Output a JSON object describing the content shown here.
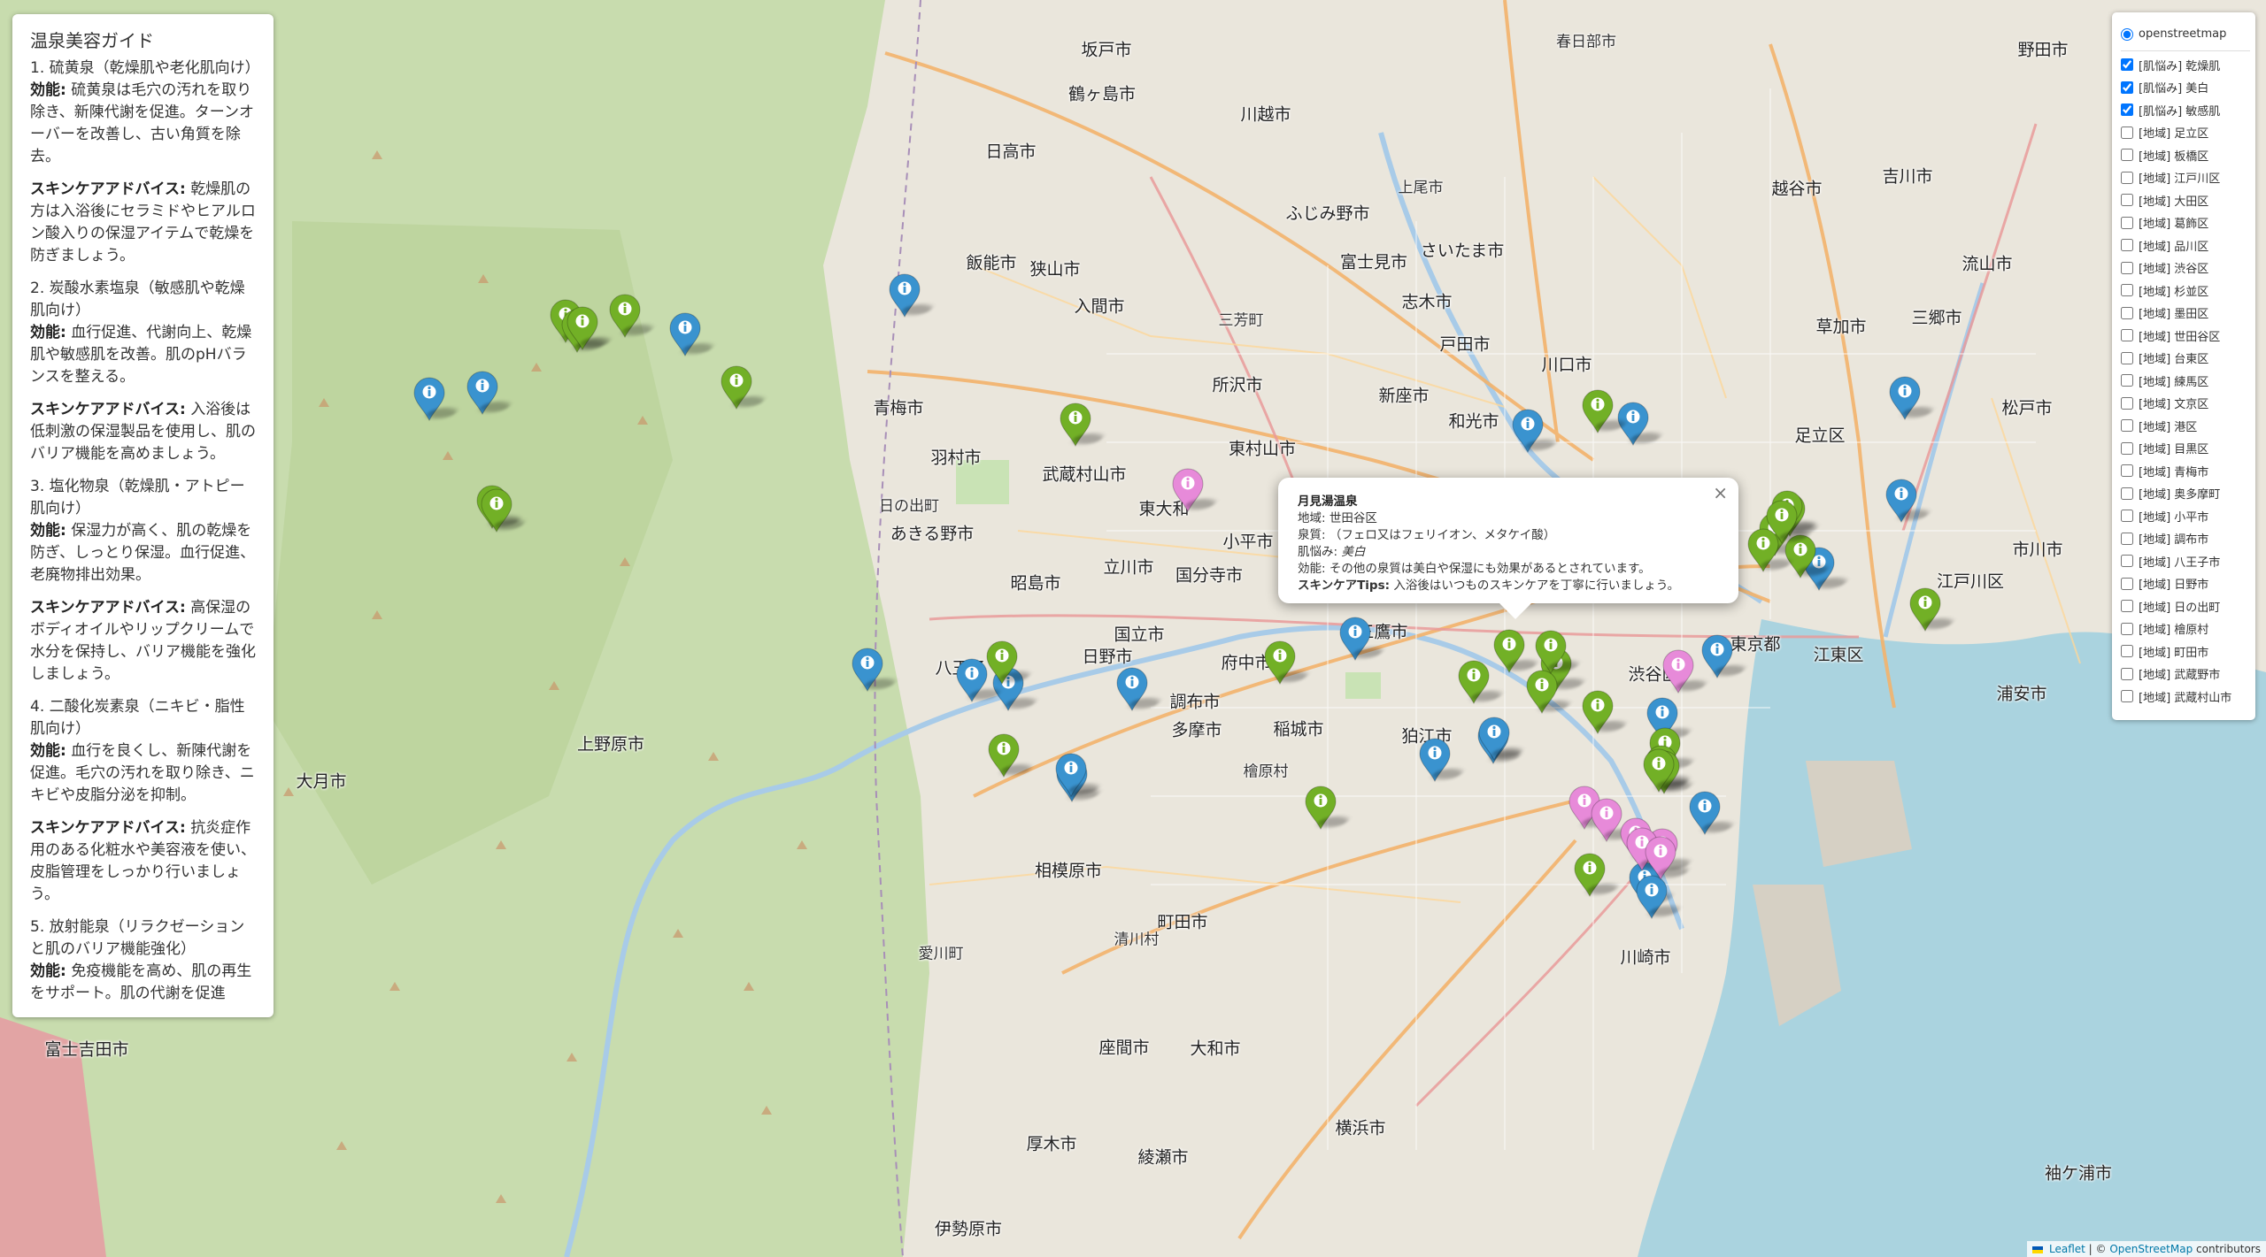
{
  "map": {
    "labels": [
      {
        "text": "坂戸市",
        "big": true
      },
      {
        "text": "鶴ヶ島市",
        "big": true
      },
      {
        "text": "日高市",
        "big": true
      },
      {
        "text": "川越市",
        "big": true
      },
      {
        "text": "ふじみ野市",
        "big": true
      },
      {
        "text": "富士見市",
        "big": true
      },
      {
        "text": "さいたま市",
        "big": true
      },
      {
        "text": "上尾市",
        "big": false
      },
      {
        "text": "春日部市",
        "big": false
      },
      {
        "text": "越谷市",
        "big": true
      },
      {
        "text": "吉川市",
        "big": true
      },
      {
        "text": "野田市",
        "big": true
      },
      {
        "text": "流山市",
        "big": true
      },
      {
        "text": "三郷市",
        "big": true
      },
      {
        "text": "草加市",
        "big": true
      },
      {
        "text": "松戸市",
        "big": true
      },
      {
        "text": "飯能市",
        "big": true
      },
      {
        "text": "狭山市",
        "big": true
      },
      {
        "text": "入間市",
        "big": true
      },
      {
        "text": "三芳町",
        "big": false
      },
      {
        "text": "志木市",
        "big": true
      },
      {
        "text": "所沢市",
        "big": true
      },
      {
        "text": "戸田市",
        "big": true
      },
      {
        "text": "川口市",
        "big": true
      },
      {
        "text": "新座市",
        "big": true
      },
      {
        "text": "和光市",
        "big": true
      },
      {
        "text": "足立区",
        "big": true
      },
      {
        "text": "青梅市",
        "big": true
      },
      {
        "text": "羽村市",
        "big": true
      },
      {
        "text": "武蔵村山市",
        "big": true
      },
      {
        "text": "東村山市",
        "big": true
      },
      {
        "text": "東大和",
        "big": true
      },
      {
        "text": "小平市",
        "big": true
      },
      {
        "text": "あきる野市",
        "big": true
      },
      {
        "text": "日の出町",
        "big": false
      },
      {
        "text": "昭島市",
        "big": true
      },
      {
        "text": "立川市",
        "big": true
      },
      {
        "text": "国分寺市",
        "big": true
      },
      {
        "text": "国立市",
        "big": true
      },
      {
        "text": "府中市",
        "big": true
      },
      {
        "text": "八王子",
        "big": true
      },
      {
        "text": "日野市",
        "big": true
      },
      {
        "text": "多摩市",
        "big": true
      },
      {
        "text": "稲城市",
        "big": true
      },
      {
        "text": "調布市",
        "big": true
      },
      {
        "text": "狛江市",
        "big": true
      },
      {
        "text": "三鷹市",
        "big": true
      },
      {
        "text": "渋谷区",
        "big": true
      },
      {
        "text": "東京都",
        "big": true
      },
      {
        "text": "江東区",
        "big": true
      },
      {
        "text": "江戸川区",
        "big": true
      },
      {
        "text": "市川市",
        "big": true
      },
      {
        "text": "浦安市",
        "big": true
      },
      {
        "text": "上野原市",
        "big": true
      },
      {
        "text": "大月市",
        "big": true
      },
      {
        "text": "相模原市",
        "big": true
      },
      {
        "text": "町田市",
        "big": true
      },
      {
        "text": "川崎市",
        "big": true
      },
      {
        "text": "座間市",
        "big": true
      },
      {
        "text": "大和市",
        "big": true
      },
      {
        "text": "厚木市",
        "big": true
      },
      {
        "text": "綾瀬市",
        "big": true
      },
      {
        "text": "横浜市",
        "big": true
      },
      {
        "text": "伊勢原市",
        "big": true
      },
      {
        "text": "富士吉田市",
        "big": true
      },
      {
        "text": "袖ケ浦市",
        "big": true
      },
      {
        "text": "愛川町",
        "big": false
      },
      {
        "text": "清川村",
        "big": false
      },
      {
        "text": "檜原村",
        "big": false
      }
    ],
    "marker_colors": {
      "blue": "#3a93cf",
      "green": "#72b026",
      "pink": "#e78ad9"
    },
    "markers": [
      {
        "color": "blue"
      },
      {
        "color": "blue"
      },
      {
        "color": "blue"
      },
      {
        "color": "blue"
      },
      {
        "color": "blue"
      },
      {
        "color": "blue"
      },
      {
        "color": "blue"
      },
      {
        "color": "blue"
      },
      {
        "color": "blue"
      },
      {
        "color": "blue"
      },
      {
        "color": "blue"
      },
      {
        "color": "blue"
      },
      {
        "color": "blue"
      },
      {
        "color": "blue"
      },
      {
        "color": "blue"
      },
      {
        "color": "blue"
      },
      {
        "color": "blue"
      },
      {
        "color": "blue"
      },
      {
        "color": "blue"
      },
      {
        "color": "blue"
      },
      {
        "color": "blue"
      },
      {
        "color": "blue"
      },
      {
        "color": "blue"
      },
      {
        "color": "blue"
      },
      {
        "color": "green"
      },
      {
        "color": "green"
      },
      {
        "color": "green"
      },
      {
        "color": "green"
      },
      {
        "color": "green"
      },
      {
        "color": "green"
      },
      {
        "color": "green"
      },
      {
        "color": "green"
      },
      {
        "color": "green"
      },
      {
        "color": "green"
      },
      {
        "color": "green"
      },
      {
        "color": "green"
      },
      {
        "color": "green"
      },
      {
        "color": "green"
      },
      {
        "color": "green"
      },
      {
        "color": "green"
      },
      {
        "color": "green"
      },
      {
        "color": "green"
      },
      {
        "color": "green"
      },
      {
        "color": "green"
      },
      {
        "color": "green"
      },
      {
        "color": "green"
      },
      {
        "color": "green"
      },
      {
        "color": "green"
      },
      {
        "color": "green"
      },
      {
        "color": "green"
      },
      {
        "color": "green"
      },
      {
        "color": "green"
      },
      {
        "color": "green"
      },
      {
        "color": "green"
      },
      {
        "color": "green"
      },
      {
        "color": "pink"
      },
      {
        "color": "pink"
      },
      {
        "color": "pink"
      },
      {
        "color": "pink"
      },
      {
        "color": "pink"
      },
      {
        "color": "pink"
      },
      {
        "color": "pink"
      },
      {
        "color": "pink"
      }
    ]
  },
  "guide": {
    "title": "温泉美容ガイド",
    "items": [
      {
        "heading": "1. 硫黄泉（乾燥肌や老化肌向け）",
        "effect_label": "効能:",
        "effect": "硫黄泉は毛穴の汚れを取り除き、新陳代謝を促進。ターンオーバーを改善し、古い角質を除去。",
        "advice_label": "スキンケアアドバイス:",
        "advice": "乾燥肌の方は入浴後にセラミドやヒアルロン酸入りの保湿アイテムで乾燥を防ぎましょう。"
      },
      {
        "heading": "2. 炭酸水素塩泉（敏感肌や乾燥肌向け）",
        "effect_label": "効能:",
        "effect": "血行促進、代謝向上、乾燥肌や敏感肌を改善。肌のpHバランスを整える。",
        "advice_label": "スキンケアアドバイス:",
        "advice": "入浴後は低刺激の保湿製品を使用し、肌のバリア機能を高めましょう。"
      },
      {
        "heading": "3. 塩化物泉（乾燥肌・アトピー肌向け）",
        "effect_label": "効能:",
        "effect": "保湿力が高く、肌の乾燥を防ぎ、しっとり保湿。血行促進、老廃物排出効果。",
        "advice_label": "スキンケアアドバイス:",
        "advice": "高保湿のボディオイルやリップクリームで水分を保持し、バリア機能を強化しましょう。"
      },
      {
        "heading": "4. 二酸化炭素泉（ニキビ・脂性肌向け）",
        "effect_label": "効能:",
        "effect": "血行を良くし、新陳代謝を促進。毛穴の汚れを取り除き、ニキビや皮脂分泌を抑制。",
        "advice_label": "スキンケアアドバイス:",
        "advice": "抗炎症作用のある化粧水や美容液を使い、皮脂管理をしっかり行いましょう。"
      },
      {
        "heading": "5. 放射能泉（リラクゼーションと肌のバリア機能強化）",
        "effect_label": "効能:",
        "effect": "免疫機能を高め、肌の再生をサポート。肌の代謝を促進",
        "advice_label": "",
        "advice": ""
      }
    ]
  },
  "layers": {
    "base": [
      {
        "label": "openstreetmap",
        "checked": true
      }
    ],
    "overlays": [
      {
        "label": "[肌悩み] 乾燥肌",
        "checked": true
      },
      {
        "label": "[肌悩み] 美白",
        "checked": true
      },
      {
        "label": "[肌悩み] 敏感肌",
        "checked": true
      },
      {
        "label": "[地域] 足立区",
        "checked": false
      },
      {
        "label": "[地域] 板橋区",
        "checked": false
      },
      {
        "label": "[地域] 江戸川区",
        "checked": false
      },
      {
        "label": "[地域] 大田区",
        "checked": false
      },
      {
        "label": "[地域] 葛飾区",
        "checked": false
      },
      {
        "label": "[地域] 品川区",
        "checked": false
      },
      {
        "label": "[地域] 渋谷区",
        "checked": false
      },
      {
        "label": "[地域] 杉並区",
        "checked": false
      },
      {
        "label": "[地域] 墨田区",
        "checked": false
      },
      {
        "label": "[地域] 世田谷区",
        "checked": false
      },
      {
        "label": "[地域] 台東区",
        "checked": false
      },
      {
        "label": "[地域] 練馬区",
        "checked": false
      },
      {
        "label": "[地域] 文京区",
        "checked": false
      },
      {
        "label": "[地域] 港区",
        "checked": false
      },
      {
        "label": "[地域] 目黒区",
        "checked": false
      },
      {
        "label": "[地域] 青梅市",
        "checked": false
      },
      {
        "label": "[地域] 奥多摩町",
        "checked": false
      },
      {
        "label": "[地域] 小平市",
        "checked": false
      },
      {
        "label": "[地域] 調布市",
        "checked": false
      },
      {
        "label": "[地域] 八王子市",
        "checked": false
      },
      {
        "label": "[地域] 日野市",
        "checked": false
      },
      {
        "label": "[地域] 日の出町",
        "checked": false
      },
      {
        "label": "[地域] 檜原村",
        "checked": false
      },
      {
        "label": "[地域] 町田市",
        "checked": false
      },
      {
        "label": "[地域] 武蔵野市",
        "checked": false
      },
      {
        "label": "[地域] 武蔵村山市",
        "checked": false
      }
    ]
  },
  "popup": {
    "name": "月見湯温泉",
    "area_label": "地域:",
    "area": "世田谷区",
    "spring_label": "泉質:",
    "spring": "（フェロ又はフェリイオン、メタケイ酸）",
    "concern_label": "肌悩み:",
    "concern": "美白",
    "effect_label": "効能:",
    "effect": "その他の泉質は美白や保湿にも効果があるとされています。",
    "tips_label": "スキンケアTips:",
    "tips": "入浴後はいつものスキンケアを丁寧に行いましょう。",
    "close": "×"
  },
  "attribution": {
    "leaflet": "Leaflet",
    "sep": " | © ",
    "osm": "OpenStreetMap",
    "suffix": " contributors"
  }
}
